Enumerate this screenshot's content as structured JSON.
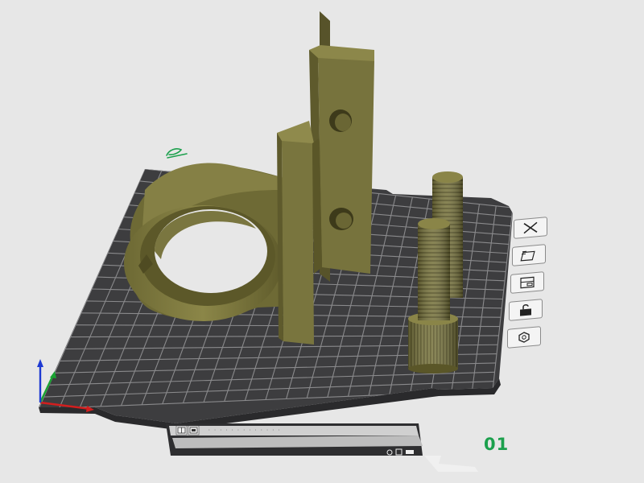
{
  "plate": {
    "index_label": "01",
    "footer_text": "· · ·  ·  · · ·  · ·  · · · ·"
  },
  "colors": {
    "background": "#e7e7e7",
    "plate": "#3d3d3f",
    "grid": "#8a8a8c",
    "model": "#77733d",
    "model_dark": "#5e5a2c",
    "model_light": "#8f8a4c",
    "axis_x": "#d21e1e",
    "axis_y": "#1aa332",
    "axis_z": "#1e3ad2",
    "plate_label": "#1ca04d"
  },
  "side_toolbar": [
    {
      "id": "delete",
      "icon": "close-icon"
    },
    {
      "id": "arrange",
      "icon": "arrange-icon"
    },
    {
      "id": "settings",
      "icon": "plate-settings-icon"
    },
    {
      "id": "lock",
      "icon": "unlock-icon"
    },
    {
      "id": "select-all",
      "icon": "hexagon-icon"
    }
  ],
  "plate_icons": [
    {
      "icon": "plate-grid-icon"
    },
    {
      "icon": "plate-copy-icon"
    },
    {
      "icon": "plate-eye-icon"
    },
    {
      "icon": "plate-square-icon"
    },
    {
      "icon": "plate-more-icon"
    }
  ]
}
